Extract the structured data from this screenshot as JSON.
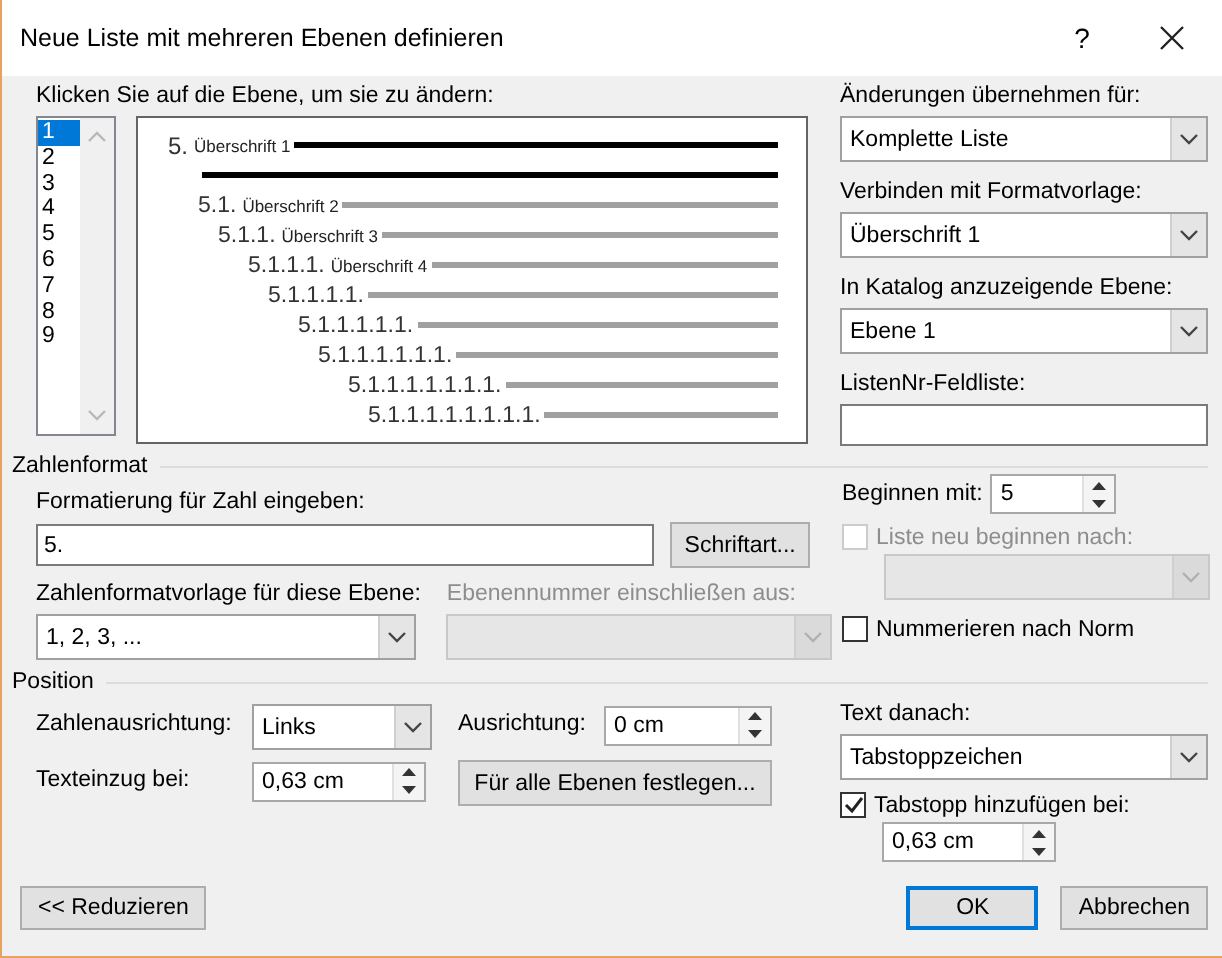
{
  "window": {
    "title": "Neue Liste mit mehreren Ebenen definieren",
    "help": "?"
  },
  "levels_label": "Klicken Sie auf die Ebene, um sie zu ändern:",
  "levels": [
    {
      "label": "1",
      "selected": true
    },
    {
      "label": "2",
      "selected": false
    },
    {
      "label": "3",
      "selected": false
    },
    {
      "label": "4",
      "selected": false
    },
    {
      "label": "5",
      "selected": false
    },
    {
      "label": "6",
      "selected": false
    },
    {
      "label": "7",
      "selected": false
    },
    {
      "label": "8",
      "selected": false
    },
    {
      "label": "9",
      "selected": false
    }
  ],
  "preview": [
    {
      "number": "5.",
      "heading": "Überschrift 1"
    },
    {
      "number": "5.1.",
      "heading": "Überschrift 2"
    },
    {
      "number": "5.1.1.",
      "heading": "Überschrift 3"
    },
    {
      "number": "5.1.1.1.",
      "heading": "Überschrift 4"
    },
    {
      "number": "5.1.1.1.1."
    },
    {
      "number": "5.1.1.1.1.1."
    },
    {
      "number": "5.1.1.1.1.1.1."
    },
    {
      "number": "5.1.1.1.1.1.1.1."
    },
    {
      "number": "5.1.1.1.1.1.1.1.1."
    }
  ],
  "apply_to": {
    "label": "Änderungen übernehmen für:",
    "value": "Komplette Liste"
  },
  "link_style": {
    "label": "Verbinden mit Formatvorlage:",
    "value": "Überschrift 1"
  },
  "gallery_level": {
    "label": "In Katalog anzuzeigende Ebene:",
    "value": "Ebene 1"
  },
  "listnum": {
    "label": "ListenNr-Feldliste:"
  },
  "number_format": {
    "title": "Zahlenformat",
    "format_label": "Formatierung für Zahl eingeben:",
    "format_value": "5.",
    "font_button": "Schriftart...",
    "style_label": "Zahlenformatvorlage für diese Ebene:",
    "style_value": "1, 2, 3, ...",
    "include_label": "Ebenennummer einschließen aus:",
    "include_disabled": true,
    "start_label": "Beginnen mit:",
    "start_value": "5",
    "restart": {
      "label": "Liste neu beginnen nach:",
      "checked": false,
      "disabled": true
    },
    "legal": {
      "label": "Nummerieren nach Norm",
      "checked": false,
      "disabled": false
    }
  },
  "position": {
    "title": "Position",
    "alignment_label": "Zahlenausrichtung:",
    "alignment_value": "Links",
    "aligned_at_label": "Ausrichtung:",
    "aligned_at_value": "0 cm",
    "indent_label": "Texteinzug bei:",
    "indent_value": "0,63 cm",
    "set_all_button": "Für alle Ebenen festlegen...",
    "follow_label": "Text danach:",
    "follow_value": "Tabstoppzeichen",
    "tab_stop": {
      "label": "Tabstopp hinzufügen bei:",
      "checked": true,
      "disabled": false
    },
    "tab_value": "0,63 cm"
  },
  "buttons": [
    {
      "label": "<< Reduzieren",
      "default": false
    },
    {
      "label": "OK",
      "default": true
    },
    {
      "label": "Abbrechen",
      "default": false
    }
  ]
}
